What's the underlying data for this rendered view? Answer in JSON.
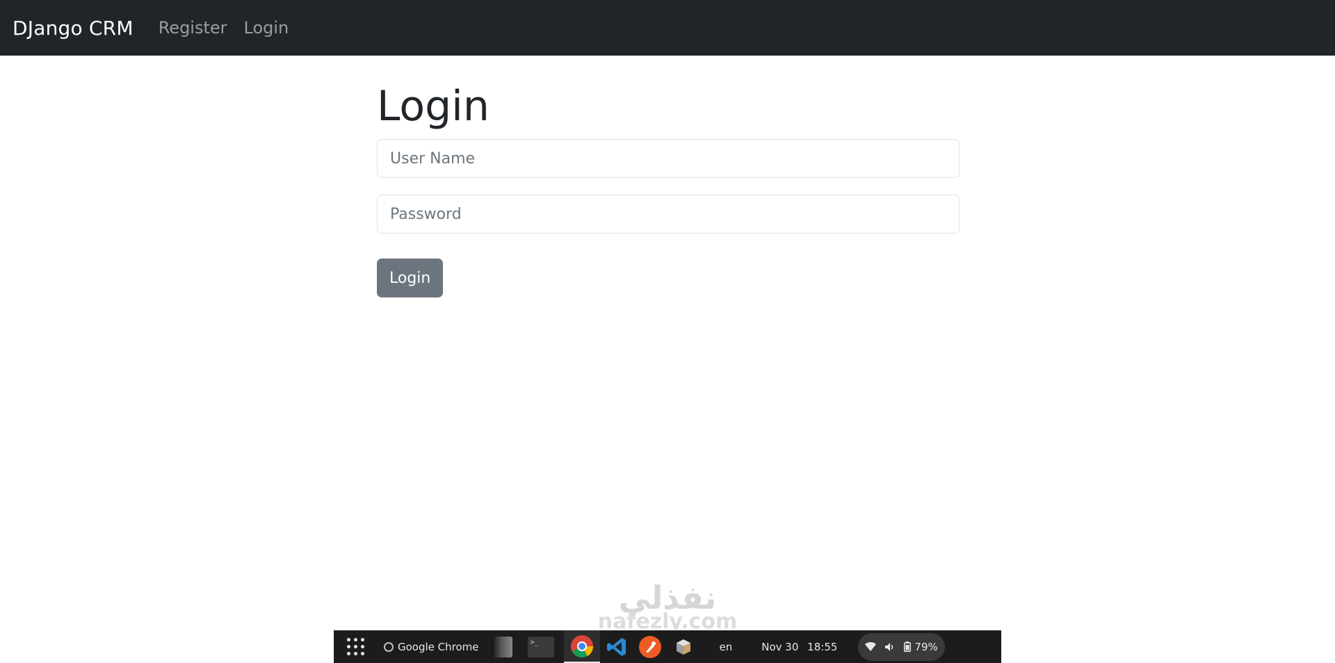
{
  "navbar": {
    "brand": "DJango CRM",
    "links": [
      "Register",
      "Login"
    ]
  },
  "main": {
    "title": "Login",
    "username_placeholder": "User Name",
    "password_placeholder": "Password",
    "submit_label": "Login"
  },
  "watermark": {
    "arabic": "نفذلي",
    "latin": "nafezly.com"
  },
  "taskbar": {
    "active_app": "Google Chrome",
    "terminal_glyph": ">_",
    "language": "en",
    "date": "Nov 30",
    "time": "18:55",
    "battery": "79%"
  },
  "colors": {
    "navbar_bg": "#212529",
    "button_bg": "#6c757d",
    "taskbar_bg": "#1c1c1c"
  },
  "icons": [
    "apps-grid-icon",
    "chrome-icon",
    "vscode-icon",
    "postman-icon",
    "box-icon",
    "wifi-icon",
    "volume-icon",
    "battery-icon"
  ]
}
